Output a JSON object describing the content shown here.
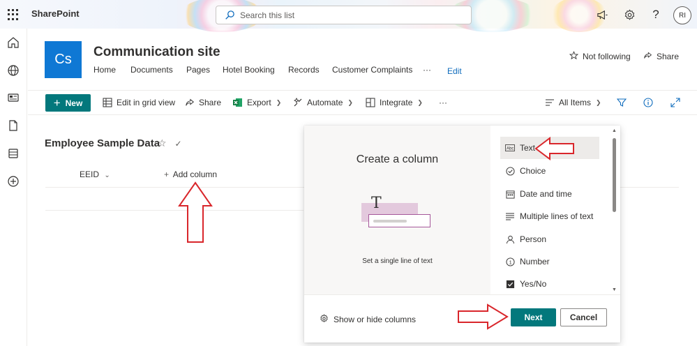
{
  "suite": {
    "app_name": "SharePoint",
    "search_placeholder": "Search this list",
    "avatar_initials": "RI",
    "icons": [
      "waffle-icon",
      "megaphone-icon",
      "gear-icon",
      "help-icon"
    ]
  },
  "rail": {
    "icons": [
      "home-icon",
      "globe-icon",
      "news-icon",
      "file-icon",
      "list-icon",
      "add-circle-icon"
    ]
  },
  "site": {
    "logo_text": "Cs",
    "title": "Communication site",
    "nav": [
      "Home",
      "Documents",
      "Pages",
      "Hotel Booking",
      "Records",
      "Customer Complaints"
    ],
    "nav_more": "···",
    "edit_label": "Edit",
    "follow_label": "Not following",
    "share_label": "Share"
  },
  "commandbar": {
    "new_label": "New",
    "grid_label": "Edit in grid view",
    "share_label": "Share",
    "export_label": "Export",
    "automate_label": "Automate",
    "integrate_label": "Integrate",
    "more_label": "···",
    "view_label": "All Items"
  },
  "list": {
    "title": "Employee Sample Data",
    "columns": [
      "EEID"
    ],
    "add_column_label": "Add column"
  },
  "panel": {
    "title": "Create a column",
    "preview_glyph": "T",
    "preview_desc": "Set a single line of text",
    "types": [
      {
        "label": "Text",
        "icon": "text-icon",
        "selected": true
      },
      {
        "label": "Choice",
        "icon": "choice-icon",
        "selected": false
      },
      {
        "label": "Date and time",
        "icon": "calendar-icon",
        "selected": false
      },
      {
        "label": "Multiple lines of text",
        "icon": "multiline-icon",
        "selected": false
      },
      {
        "label": "Person",
        "icon": "person-icon",
        "selected": false
      },
      {
        "label": "Number",
        "icon": "number-icon",
        "selected": false
      },
      {
        "label": "Yes/No",
        "icon": "yesno-icon",
        "selected": false
      }
    ],
    "show_hide_label": "Show or hide columns",
    "next_label": "Next",
    "cancel_label": "Cancel"
  },
  "colors": {
    "accent": "#03787c",
    "site_logo": "#0f78d4",
    "annotation_arrow": "#d9262b"
  }
}
